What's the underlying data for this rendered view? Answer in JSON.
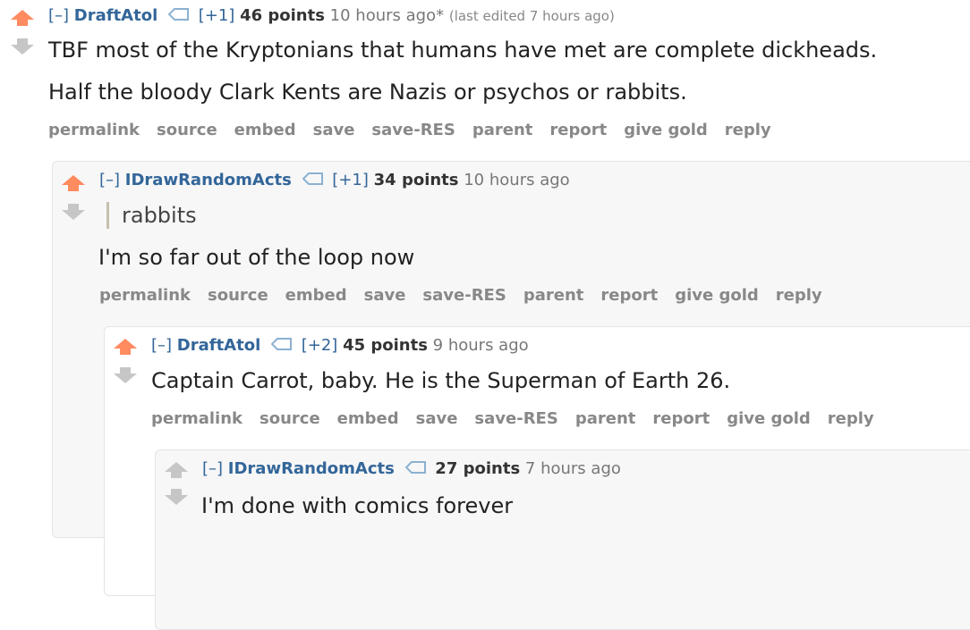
{
  "comments": [
    {
      "expand": "[–]",
      "author": "DraftAtol",
      "vote_tag": "[+1]",
      "score": "46 points",
      "time": "10 hours ago*",
      "edited": "(last edited 7 hours ago)",
      "paragraphs": [
        "TBF most of the Kryptonians that humans have met are complete dickheads.",
        "Half the bloody Clark Kents are Nazis or psychos or rabbits."
      ]
    },
    {
      "expand": "[–]",
      "author": "IDrawRandomActs",
      "vote_tag": "[+1]",
      "score": "34 points",
      "time": "10 hours ago",
      "quote": "rabbits",
      "paragraphs": [
        "I'm so far out of the loop now"
      ]
    },
    {
      "expand": "[–]",
      "author": "DraftAtol",
      "vote_tag": "[+2]",
      "score": "45 points",
      "time": "9 hours ago",
      "paragraphs": [
        "Captain Carrot, baby. He is the Superman of Earth 26."
      ]
    },
    {
      "expand": "[–]",
      "author": "IDrawRandomActs",
      "score": "27 points",
      "time": "7 hours ago",
      "paragraphs": [
        "I'm done with comics forever"
      ]
    }
  ],
  "buttons": {
    "permalink": "permalink",
    "source": "source",
    "embed": "embed",
    "save": "save",
    "save_res": "save-RES",
    "parent": "parent",
    "report": "report",
    "give_gold": "give gold",
    "reply": "reply"
  },
  "colors": {
    "upvote_active": "#ff8b60",
    "downvote": "#c6c6c6",
    "author": "#336699",
    "buttons": "#888888",
    "nested_bg": "#f7f7f8"
  }
}
